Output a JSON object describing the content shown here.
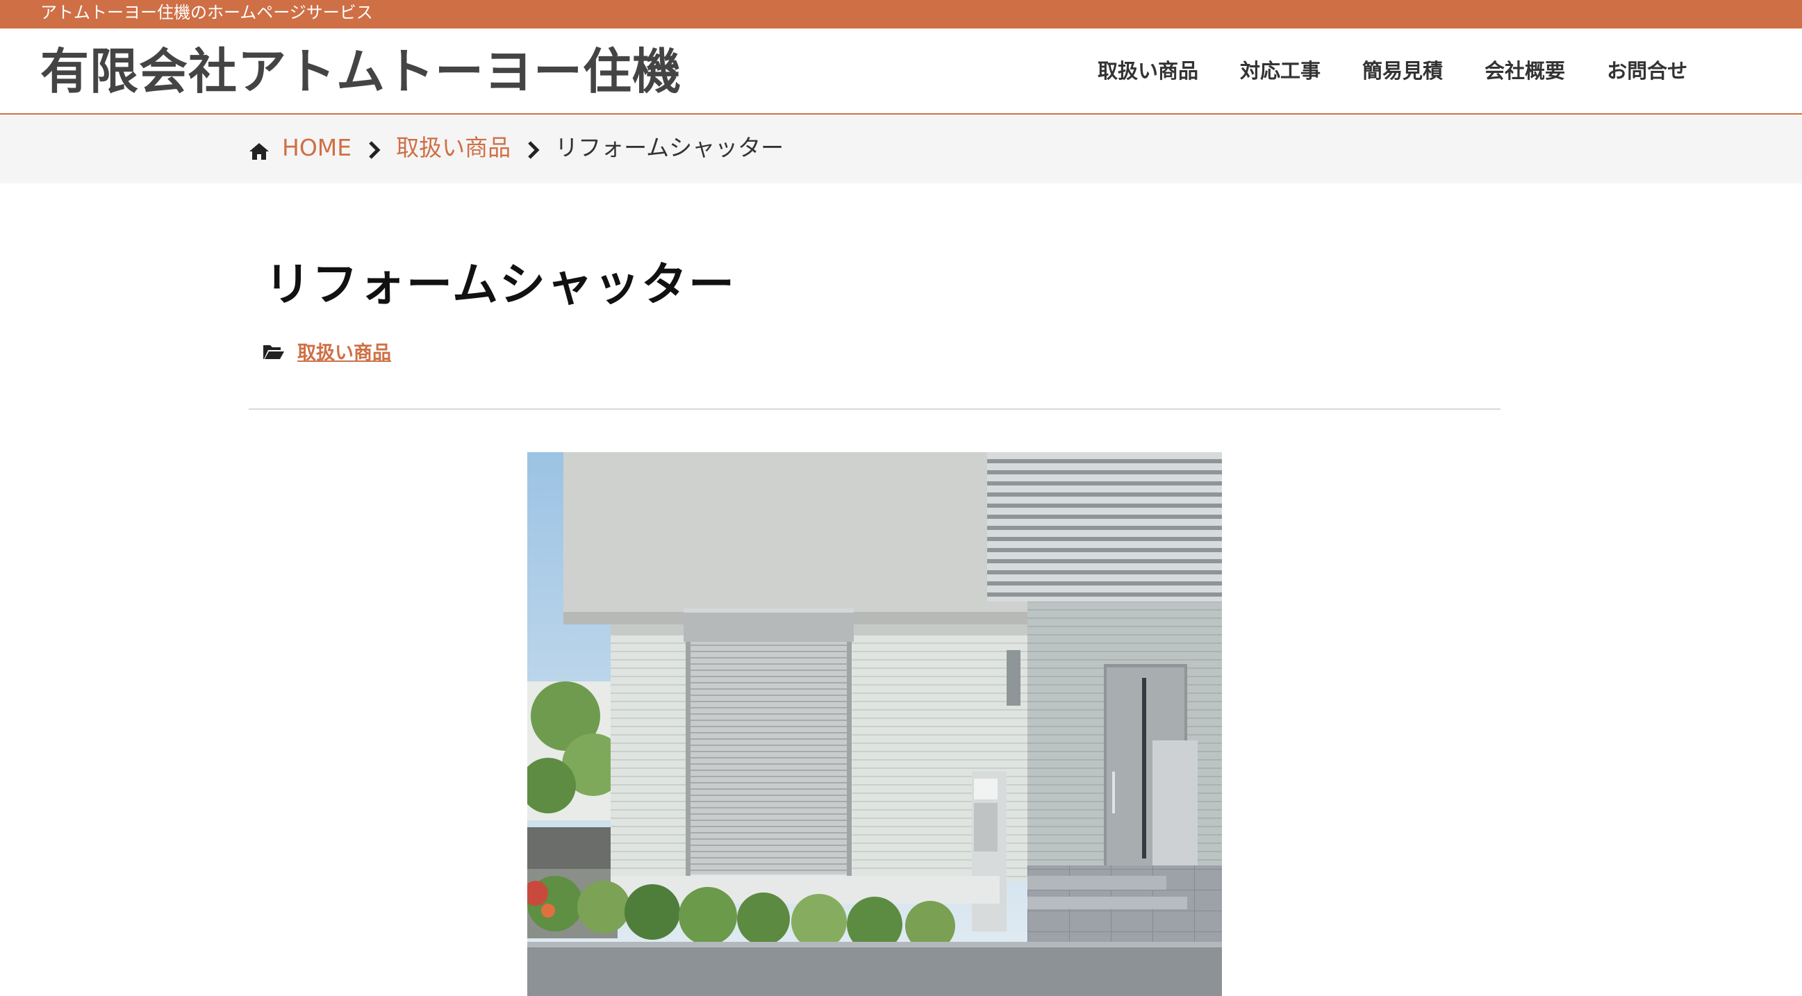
{
  "topbar": {
    "tagline": "アトムトーヨー住機のホームページサービス"
  },
  "header": {
    "site_title": "有限会社アトムトーヨー住機"
  },
  "nav": {
    "items": [
      {
        "label": "取扱い商品"
      },
      {
        "label": "対応工事"
      },
      {
        "label": "簡易見積"
      },
      {
        "label": "会社概要"
      },
      {
        "label": "お問合せ"
      }
    ]
  },
  "breadcrumb": {
    "home_icon": "home-icon",
    "separator_icon": "chevron-right-icon",
    "home": "HOME",
    "category": "取扱い商品",
    "current": "リフォームシャッター"
  },
  "article": {
    "title": "リフォームシャッター",
    "category_icon": "folder-open-icon",
    "category": "取扱い商品"
  },
  "hero_image": {
    "subject": "house-with-shutter-photo"
  },
  "colors": {
    "accent": "#cf6f45",
    "breadcrumb_bg": "#f5f5f5",
    "divider": "#d8d8d8"
  }
}
